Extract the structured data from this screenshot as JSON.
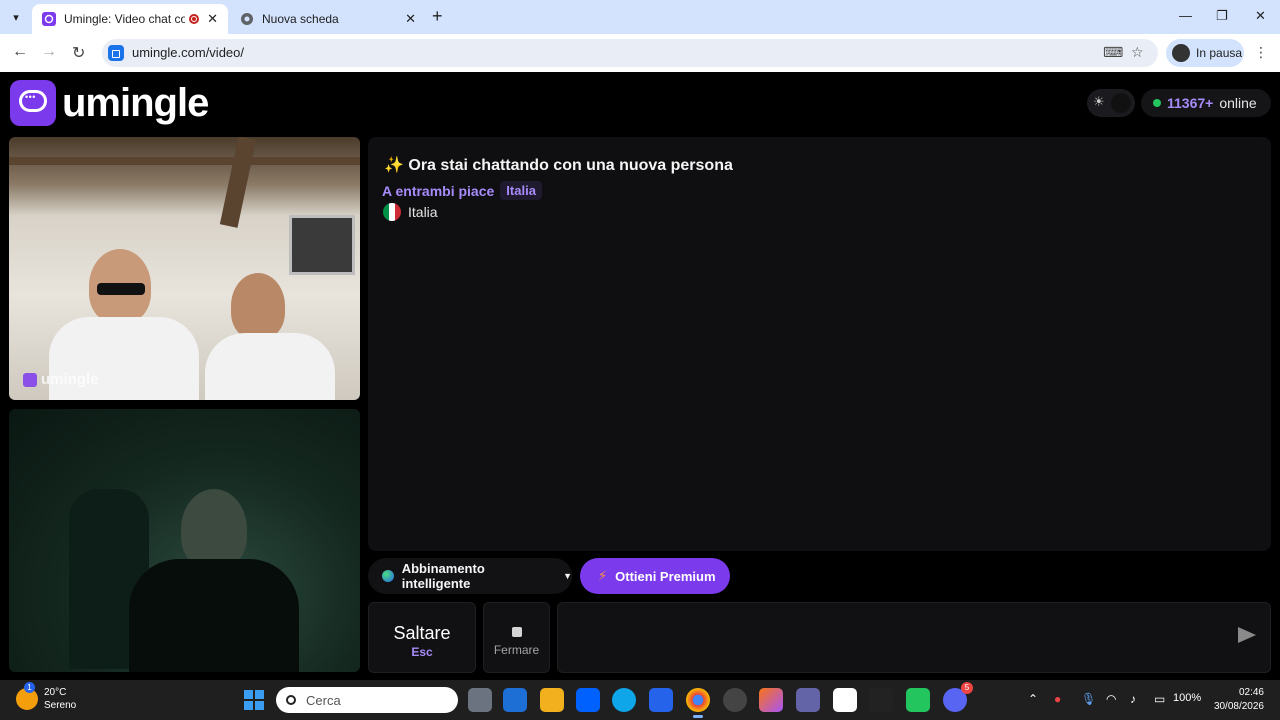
{
  "browser": {
    "tabs": [
      {
        "title": "Umingle: Video chat con sc",
        "active": true
      },
      {
        "title": "Nuova scheda",
        "active": false
      }
    ],
    "url": "umingle.com/video/",
    "profile_label": "In pausa"
  },
  "site": {
    "logo_text": "umingle",
    "online_count": "11367+",
    "online_label": "online"
  },
  "chat": {
    "title": "✨ Ora stai chattando con una nuova persona",
    "likes_label": "A entrambi piace",
    "likes_tag": "Italia",
    "country": "Italia",
    "watermark": "umingle"
  },
  "controls": {
    "match_label": "Abbinamento intelligente",
    "premium_label": "Ottieni Premium",
    "skip_label": "Saltare",
    "skip_key": "Esc",
    "stop_label": "Fermare",
    "message_placeholder": ""
  },
  "taskbar": {
    "temperature": "20°C",
    "weather": "Sereno",
    "search_label": "Cerca",
    "battery": "100%",
    "time": "02:46",
    "date": "30/08/2026",
    "discord_badge": "5"
  },
  "colors": {
    "accent": "#7c3aed",
    "accent_light": "#a78bfa",
    "online_dot": "#22c55e",
    "page_bg": "#000000"
  }
}
